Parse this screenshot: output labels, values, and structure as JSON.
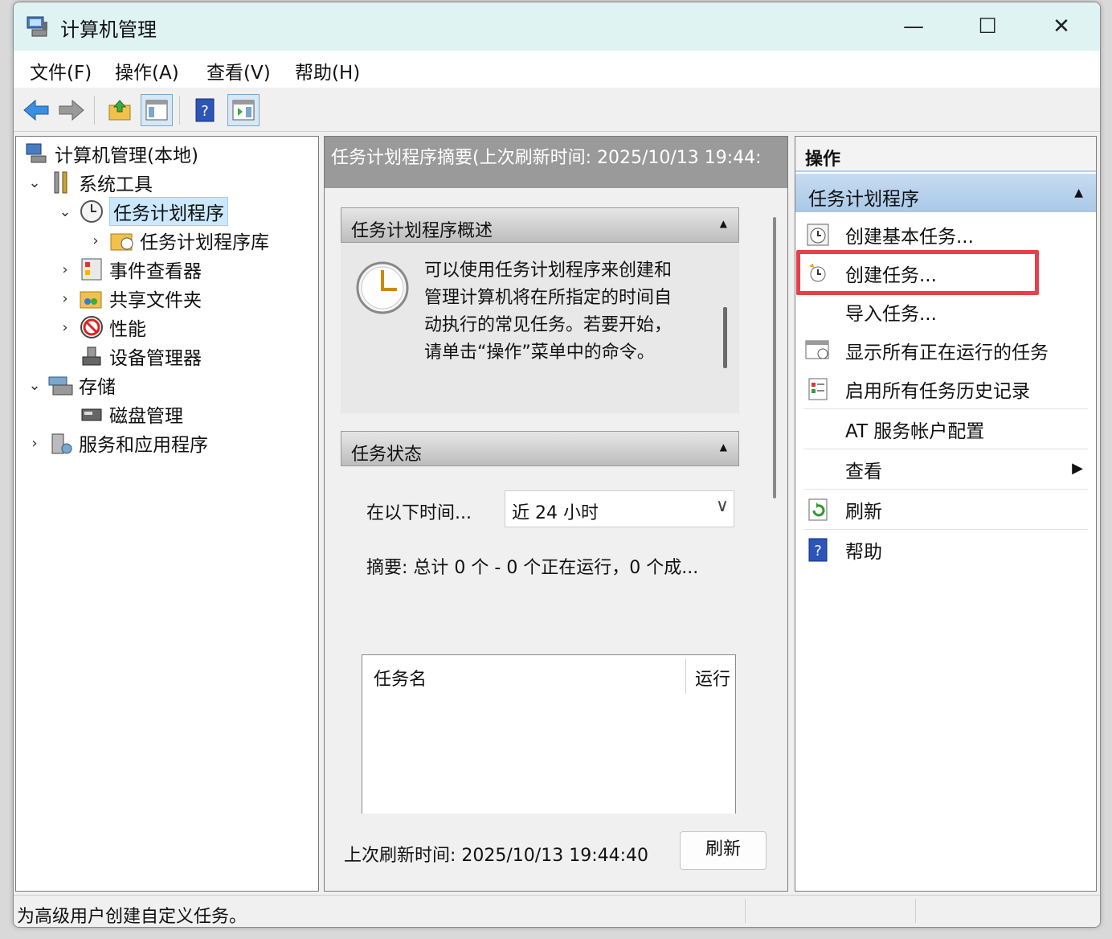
{
  "window": {
    "title": "计算机管理"
  },
  "menu": [
    "文件(F)",
    "操作(A)",
    "查看(V)",
    "帮助(H)"
  ],
  "tree": {
    "root": "计算机管理(本地)",
    "system_tools": "系统工具",
    "task_scheduler": "任务计划程序",
    "task_library": "任务计划程序库",
    "event_viewer": "事件查看器",
    "shared_folders": "共享文件夹",
    "performance": "性能",
    "device_manager": "设备管理器",
    "storage": "存储",
    "disk_management": "磁盘管理",
    "services_apps": "服务和应用程序"
  },
  "middle": {
    "header": "任务计划程序摘要(上次刷新时间: 2025/10/13 19:44:",
    "overview_title": "任务计划程序概述",
    "overview_text": "可以使用任务计划程序来创建和管理计算机将在所指定的时间自动执行的常见任务。若要开始，请单击“操作”菜单中的命令。",
    "status_title": "任务状态",
    "time_label": "在以下时间...",
    "time_value": "近 24 小时",
    "summary": "摘要: 总计 0 个 - 0 个正在运行，0 个成...",
    "col_name": "任务名",
    "col_run": "运行",
    "last_refresh": "上次刷新时间: 2025/10/13 19:44:40",
    "refresh_button": "刷新"
  },
  "actions": {
    "header": "操作",
    "group": "任务计划程序",
    "items": [
      "创建基本任务...",
      "创建任务...",
      "导入任务...",
      "显示所有正在运行的任务",
      "启用所有任务历史记录",
      "AT 服务帐户配置",
      "查看",
      "刷新",
      "帮助"
    ]
  },
  "status": "为高级用户创建自定义任务。",
  "colors": {
    "highlight_box": "#e8404a",
    "selection": "#cce8ff",
    "action_group": "#b3cfeb"
  }
}
